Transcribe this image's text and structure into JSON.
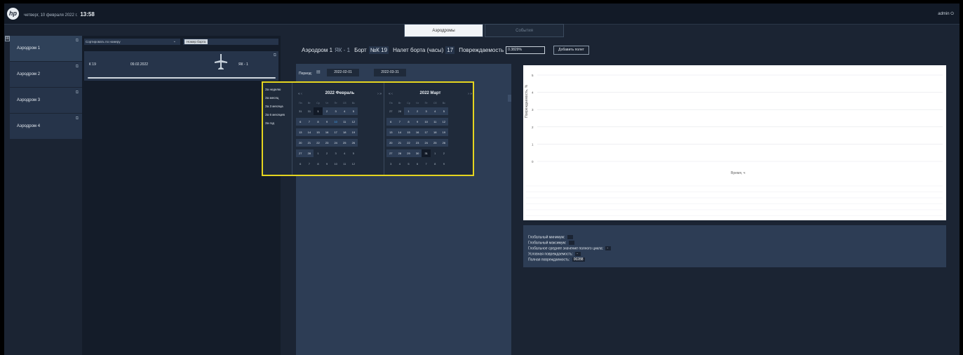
{
  "header": {
    "logo_text": "hp",
    "date_text": "четверг, 10 февраля 2022 г.",
    "time_text": "13:58",
    "user": "admin",
    "power_icon": "⏻"
  },
  "tabs": [
    {
      "label": "Аэродромы"
    },
    {
      "label": "События"
    }
  ],
  "expand_glyph": "⊞",
  "edit_glyph": "⧉",
  "sidebar": {
    "items": [
      {
        "label": "Аэродром 1"
      },
      {
        "label": "Аэродром 2"
      },
      {
        "label": "Аэродром 3"
      },
      {
        "label": "Аэродром 4"
      }
    ]
  },
  "boards": {
    "sort_label": "Сортировать по номеру",
    "sort_caret": "⌄",
    "board_search_placeholder": "Номер борта",
    "card": {
      "number": "К 19",
      "date": "09.02.2022",
      "type": "ЯК - 1"
    }
  },
  "info": {
    "aerodrome": "Аэродром 1",
    "type": "ЯК - 1",
    "board_key": "Борт",
    "board_val": "№К 19",
    "flight_key": "Налет борта (часы)",
    "flight_val": "17",
    "damage_key": "Повреждаемость",
    "damage_val": "0.3829%",
    "add_flight": "Добавить полет"
  },
  "period": {
    "label": "Период:",
    "icon": "▤",
    "from": "2022-02-01",
    "to": "2022-03-31"
  },
  "popup": {
    "ranges": [
      "За неделю",
      "За месяц",
      "За 3 месяца",
      "За 6 месяцев",
      "За год"
    ],
    "nav_prev": "«  ‹",
    "nav_next": "›  »",
    "weekdays": [
      "Пн",
      "Вт",
      "Ср",
      "Чт",
      "Пт",
      "Сб",
      "Вс"
    ],
    "left": {
      "title": "2022 Февраль",
      "weeks": [
        [
          "31",
          "31",
          "1",
          "2",
          "3",
          "4",
          "5"
        ],
        [
          "6",
          "7",
          "8",
          "9",
          "10",
          "11",
          "12"
        ],
        [
          "13",
          "14",
          "15",
          "16",
          "17",
          "18",
          "19"
        ],
        [
          "20",
          "21",
          "22",
          "23",
          "24",
          "25",
          "26"
        ],
        [
          "27",
          "28",
          "1",
          "2",
          "3",
          "4",
          "5"
        ],
        [
          "6",
          "7",
          "8",
          "9",
          "10",
          "11",
          "12"
        ]
      ]
    },
    "right": {
      "title": "2022 Март",
      "weeks": [
        [
          "27",
          "28",
          "1",
          "2",
          "3",
          "4",
          "5"
        ],
        [
          "6",
          "7",
          "8",
          "9",
          "10",
          "11",
          "12"
        ],
        [
          "13",
          "14",
          "15",
          "16",
          "17",
          "18",
          "19"
        ],
        [
          "20",
          "21",
          "22",
          "23",
          "24",
          "25",
          "26"
        ],
        [
          "27",
          "28",
          "29",
          "30",
          "31",
          "1",
          "2"
        ],
        [
          "3",
          "4",
          "5",
          "6",
          "7",
          "8",
          "9"
        ]
      ]
    }
  },
  "chart": {
    "ylabel": "Повреждаемость, %",
    "xlabel": "Время, ч",
    "yticks": [
      "5",
      "4",
      "3",
      "2",
      "1",
      "0"
    ]
  },
  "stats": {
    "global_min_label": "Глобальный минимум:",
    "global_min": "",
    "global_max_label": "Глобальный максимум:",
    "global_max": "",
    "global_avg_label": "Глобальное среднее значение полного цикла:",
    "global_avg": "-",
    "cond_label": "Условная повреждаемость:",
    "cond": "-",
    "full_label": "Полная повреждаемость:",
    "full": "00288"
  }
}
